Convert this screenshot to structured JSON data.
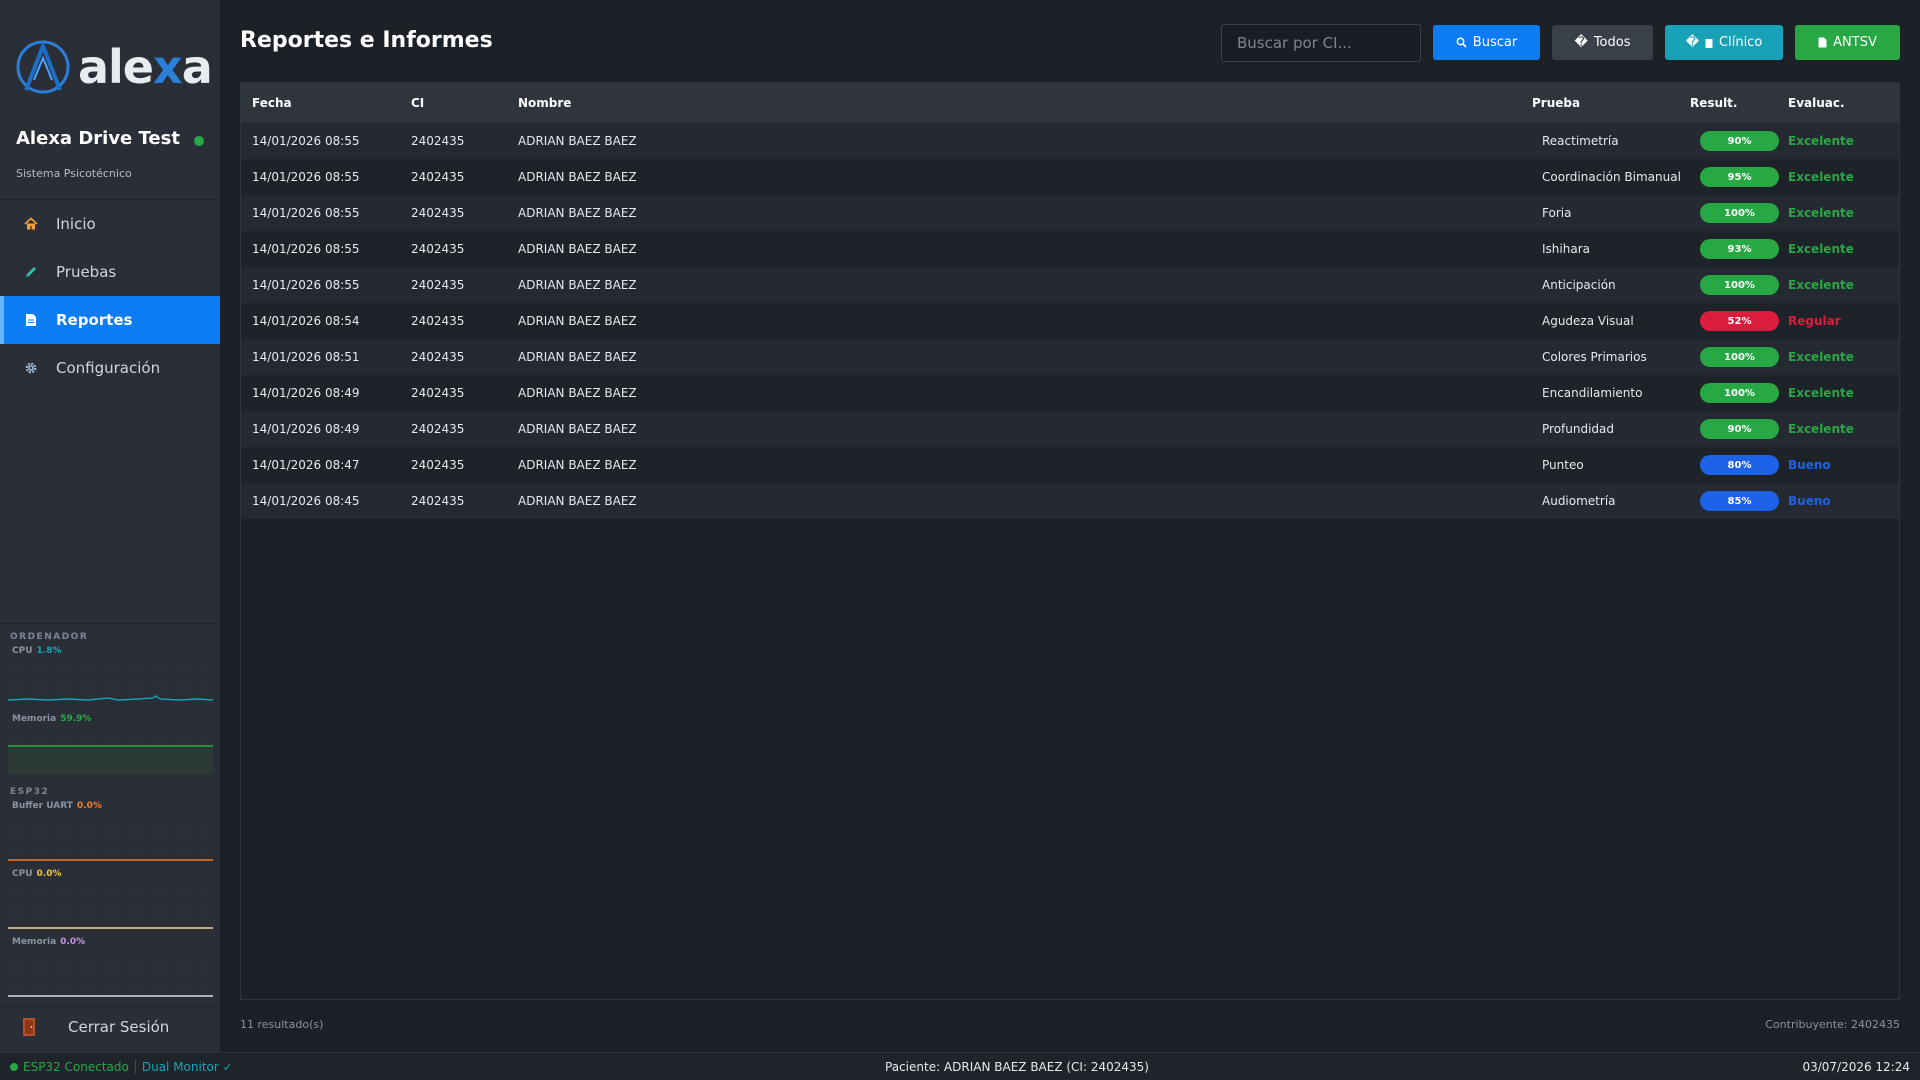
{
  "colors": {
    "primary": "#0d7cf2",
    "success": "#28a745",
    "danger": "#dc1c3f",
    "info": "#17a2b8",
    "neutral": "#3a4049",
    "good": "#1e62e8"
  },
  "sidebar": {
    "logo_text_a": "ale",
    "logo_text_x": "x",
    "logo_text_b": "a",
    "app_title": "Alexa Drive Test",
    "app_subtitle": "Sistema Psicotécnico",
    "nav": [
      {
        "label": "Inicio",
        "icon": "home-icon"
      },
      {
        "label": "Pruebas",
        "icon": "pencil-icon"
      },
      {
        "label": "Reportes",
        "icon": "document-icon",
        "active": true
      },
      {
        "label": "Configuración",
        "icon": "gear-icon"
      }
    ],
    "monitor": {
      "ordenador_title": "ORDENADOR",
      "cpu_label": "CPU",
      "cpu_value": "1.8%",
      "mem_label": "Memoria",
      "mem_value": "59.9%",
      "esp32_title": "ESP32",
      "uart_label": "Buffer UART",
      "uart_value": "0.0%",
      "esp_cpu_label": "CPU",
      "esp_cpu_value": "0.0%",
      "esp_mem_label": "Memoria",
      "esp_mem_value": "0.0%"
    },
    "logout_label": "Cerrar Sesión"
  },
  "header": {
    "title": "Reportes e Informes",
    "search_placeholder": "Buscar por CI...",
    "buttons": {
      "buscar": "Buscar",
      "todos": "Todos",
      "todos_prefix": "�",
      "clinico": "Clínico",
      "clinico_prefix": "�",
      "antsv": "ANTSV"
    }
  },
  "table": {
    "columns": {
      "fecha": "Fecha",
      "ci": "CI",
      "nombre": "Nombre",
      "prueba": "Prueba",
      "result": "Result.",
      "evaluac": "Evaluac."
    },
    "rows": [
      {
        "fecha": "14/01/2026 08:55",
        "ci": "2402435",
        "nombre": "ADRIAN BAEZ BAEZ",
        "prueba": "Reactimetría",
        "result": "90%",
        "eval": "Excelente",
        "level": "excelente"
      },
      {
        "fecha": "14/01/2026 08:55",
        "ci": "2402435",
        "nombre": "ADRIAN BAEZ BAEZ",
        "prueba": "Coordinación Bimanual",
        "result": "95%",
        "eval": "Excelente",
        "level": "excelente"
      },
      {
        "fecha": "14/01/2026 08:55",
        "ci": "2402435",
        "nombre": "ADRIAN BAEZ BAEZ",
        "prueba": "Foria",
        "result": "100%",
        "eval": "Excelente",
        "level": "excelente"
      },
      {
        "fecha": "14/01/2026 08:55",
        "ci": "2402435",
        "nombre": "ADRIAN BAEZ BAEZ",
        "prueba": "Ishihara",
        "result": "93%",
        "eval": "Excelente",
        "level": "excelente"
      },
      {
        "fecha": "14/01/2026 08:55",
        "ci": "2402435",
        "nombre": "ADRIAN BAEZ BAEZ",
        "prueba": "Anticipación",
        "result": "100%",
        "eval": "Excelente",
        "level": "excelente"
      },
      {
        "fecha": "14/01/2026 08:54",
        "ci": "2402435",
        "nombre": "ADRIAN BAEZ BAEZ",
        "prueba": "Agudeza Visual",
        "result": "52%",
        "eval": "Regular",
        "level": "regular"
      },
      {
        "fecha": "14/01/2026 08:51",
        "ci": "2402435",
        "nombre": "ADRIAN BAEZ BAEZ",
        "prueba": "Colores Primarios",
        "result": "100%",
        "eval": "Excelente",
        "level": "excelente"
      },
      {
        "fecha": "14/01/2026 08:49",
        "ci": "2402435",
        "nombre": "ADRIAN BAEZ BAEZ",
        "prueba": "Encandilamiento",
        "result": "100%",
        "eval": "Excelente",
        "level": "excelente"
      },
      {
        "fecha": "14/01/2026 08:49",
        "ci": "2402435",
        "nombre": "ADRIAN BAEZ BAEZ",
        "prueba": "Profundidad",
        "result": "90%",
        "eval": "Excelente",
        "level": "excelente"
      },
      {
        "fecha": "14/01/2026 08:47",
        "ci": "2402435",
        "nombre": "ADRIAN BAEZ BAEZ",
        "prueba": "Punteo",
        "result": "80%",
        "eval": "Bueno",
        "level": "bueno"
      },
      {
        "fecha": "14/01/2026 08:45",
        "ci": "2402435",
        "nombre": "ADRIAN BAEZ BAEZ",
        "prueba": "Audiometría",
        "result": "85%",
        "eval": "Bueno",
        "level": "bueno"
      }
    ]
  },
  "footer": {
    "result_count": "11 resultado(s)",
    "taxpayer": "Contribuyente: 2402435"
  },
  "statusbar": {
    "esp32": "ESP32 Conectado",
    "dual_monitor": "Dual Monitor ✓",
    "patient": "Paciente: ADRIAN BAEZ BAEZ (CI: 2402435)",
    "datetime": "03/07/2026 12:24"
  }
}
